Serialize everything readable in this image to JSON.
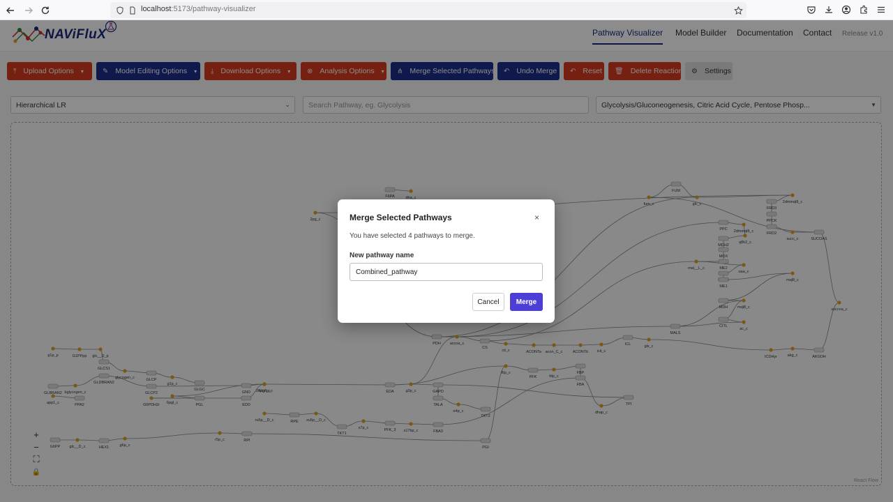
{
  "browser": {
    "url_host": "localhost",
    "url_path": ":5173/pathway-visualizer"
  },
  "app": {
    "logo_text": "NAViFluX",
    "nav": [
      {
        "label": "Pathway Visualizer",
        "active": true
      },
      {
        "label": "Model Builder",
        "active": false
      },
      {
        "label": "Documentation",
        "active": false
      },
      {
        "label": "Contact",
        "active": false
      }
    ],
    "release": "Release v1.0"
  },
  "toolbar": {
    "upload": "Upload Options",
    "model_editing": "Model Editing Options",
    "download": "Download Options",
    "analysis": "Analysis Options",
    "merge_selected": "Merge Selected Pathways",
    "undo_merge": "Undo Merge",
    "reset": "Reset",
    "delete_reaction": "Delete Reaction",
    "settings": "Settings",
    "colors": {
      "red": "#d63b1e",
      "navy": "#1e2f8a",
      "grey": "#dedede"
    }
  },
  "controls": {
    "layout_value": "Hierarchical LR",
    "search_placeholder": "Search Pathway, eg. Glycolysis",
    "pathways_value": "Glycolysis/Gluconeogenesis, Citric Acid Cycle, Pentose Phosp..."
  },
  "canvas": {
    "attribution": "React Flow",
    "node_labels": [
      {
        "label": "F6PA"
      },
      {
        "label": "dha_c"
      },
      {
        "label": "2pg_c"
      },
      {
        "label": "FUM"
      },
      {
        "label": "fum_c"
      },
      {
        "label": "glc_c"
      },
      {
        "label": "2dmmql8_c"
      },
      {
        "label": "FRD3"
      },
      {
        "label": "PPCK"
      },
      {
        "label": "FRD2"
      },
      {
        "label": "succ_c"
      },
      {
        "label": "SUCOAS"
      },
      {
        "label": "PPC"
      },
      {
        "label": "2dmmql8_c"
      },
      {
        "label": "q8h2_c"
      },
      {
        "label": "MDH2"
      },
      {
        "label": "MOX"
      },
      {
        "label": "ME2"
      },
      {
        "label": "mal__L_c"
      },
      {
        "label": "oaa_c"
      },
      {
        "label": "MDH3"
      },
      {
        "label": "ME1"
      },
      {
        "label": "mql8_c"
      },
      {
        "label": "MDH"
      },
      {
        "label": "mql8_c"
      },
      {
        "label": "succoa_c"
      },
      {
        "label": "CITL"
      },
      {
        "label": "ac_c"
      },
      {
        "label": "MALS"
      },
      {
        "label": "PDH"
      },
      {
        "label": "accoa_c"
      },
      {
        "label": "CS"
      },
      {
        "label": "cit_c"
      },
      {
        "label": "ACONTa"
      },
      {
        "label": "acon_C_c"
      },
      {
        "label": "ACONTb"
      },
      {
        "label": "icit_c"
      },
      {
        "label": "ICL"
      },
      {
        "label": "glx_c"
      },
      {
        "label": "ICDHyr"
      },
      {
        "label": "akg_c"
      },
      {
        "label": "AKGDH"
      },
      {
        "label": "f6p_c"
      },
      {
        "label": "PFK"
      },
      {
        "label": "fdp_c"
      },
      {
        "label": "FBP"
      },
      {
        "label": "FBA"
      },
      {
        "label": "g1p_p"
      },
      {
        "label": "G1PPpp"
      },
      {
        "label": "glc__D_p"
      },
      {
        "label": "GLCS1"
      },
      {
        "label": "glycogen_c"
      },
      {
        "label": "GLCP"
      },
      {
        "label": "g1p_c"
      },
      {
        "label": "GLGC"
      },
      {
        "label": "GLBRAN2"
      },
      {
        "label": "bglycogen_c"
      },
      {
        "label": "GLDBRAN2"
      },
      {
        "label": "GLCP2"
      },
      {
        "label": "GND"
      },
      {
        "label": "6pgc_c"
      },
      {
        "label": "6pgl_c"
      },
      {
        "label": "PGL"
      },
      {
        "label": "G6PDH2r"
      },
      {
        "label": "EDD"
      },
      {
        "label": "2ddg6p_c"
      },
      {
        "label": "EDA"
      },
      {
        "label": "g3p_c"
      },
      {
        "label": "GAPD"
      },
      {
        "label": "TALA"
      },
      {
        "label": "e4p_c"
      },
      {
        "label": "TKT2"
      },
      {
        "label": "dhap_c"
      },
      {
        "label": "TPI"
      },
      {
        "label": "app1_c"
      },
      {
        "label": "PPA2"
      },
      {
        "label": "ru5p__D_c"
      },
      {
        "label": "RPE"
      },
      {
        "label": "xu5p__D_c"
      },
      {
        "label": "TKT1"
      },
      {
        "label": "s7p_c"
      },
      {
        "label": "PFK_3"
      },
      {
        "label": "s17bp_c"
      },
      {
        "label": "FBA3"
      },
      {
        "label": "G6PP"
      },
      {
        "label": "glc__D_c"
      },
      {
        "label": "HEX1"
      },
      {
        "label": "g6p_c"
      },
      {
        "label": "r5p_c"
      },
      {
        "label": "RPI"
      },
      {
        "label": "PGI"
      }
    ]
  },
  "modal": {
    "title": "Merge Selected Pathways",
    "close": "×",
    "description": "You have selected 4 pathways to merge.",
    "name_label": "New pathway name",
    "name_value": "Combined_pathway",
    "cancel": "Cancel",
    "merge": "Merge",
    "accent": "#4b3fd6"
  }
}
